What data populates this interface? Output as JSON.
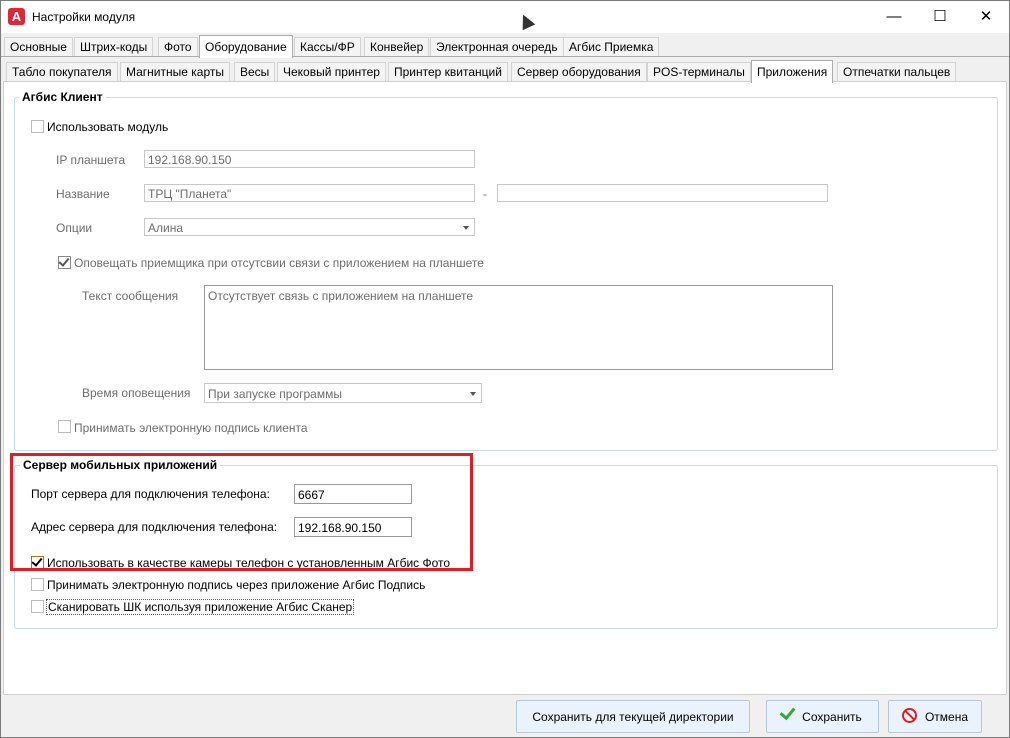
{
  "window": {
    "title": "Настройки модуля",
    "icon_letter": "A",
    "controls": {
      "minimize": "—",
      "maximize": "☐",
      "close": "✕"
    }
  },
  "tabs_top": [
    "Основные",
    "Штрих-коды",
    "Фото",
    "Оборудование",
    "Кассы/ФР",
    "Конвейер",
    "Электронная очередь",
    "Агбис Приемка"
  ],
  "tabs_top_active": "Оборудование",
  "tabs_sub": [
    "Табло покупателя",
    "Магнитные карты",
    "Весы",
    "Чековый принтер",
    "Принтер квитанций",
    "Сервер оборудования",
    "POS-терминалы",
    "Приложения",
    "Отпечатки пальцев"
  ],
  "tabs_sub_active": "Приложения",
  "client_group": {
    "title": "Агбис Клиент",
    "use_module_label": "Использовать модуль",
    "use_module_checked": false,
    "ip_label": "IP планшета",
    "ip_value": "192.168.90.150",
    "name_label": "Название",
    "name_value": "ТРЦ \"Планета\"",
    "name_separator": "-",
    "name_value2": "",
    "options_label": "Опции",
    "options_value": "Алина",
    "notify_label": "Оповещать приемщика при отсутсвии связи с приложением на планшете",
    "notify_checked": true,
    "message_label": "Текст сообщения",
    "message_value": "Отсутствует связь с приложением на планшете",
    "notify_time_label": "Время оповещения",
    "notify_time_value": "При запуске программы",
    "accept_sign_label": "Принимать электронную подпись клиента",
    "accept_sign_checked": false
  },
  "mobile_group": {
    "title": "Сервер мобильных приложений",
    "port_label": "Порт сервера для подключения телефона:",
    "port_value": "6667",
    "address_label": "Адрес сервера для подключения телефона:",
    "address_value": "192.168.90.150",
    "use_camera_label": "Использовать в качестве камеры телефон с установленным Агбис Фото",
    "use_camera_checked": true,
    "accept_sign_label": "Принимать электронную подпись через приложение Агбис Подпись",
    "accept_sign_checked": false,
    "scan_label": "Сканировать ШК используя приложение Агбис Сканер",
    "scan_checked": false
  },
  "footer": {
    "save_dir_label": "Сохранить для текущей директории",
    "save_label": "Сохранить",
    "cancel_label": "Отмена"
  },
  "colors": {
    "highlight": "#e01c24",
    "tab_border": "#acacac",
    "group_border": "#c8d9e8"
  }
}
